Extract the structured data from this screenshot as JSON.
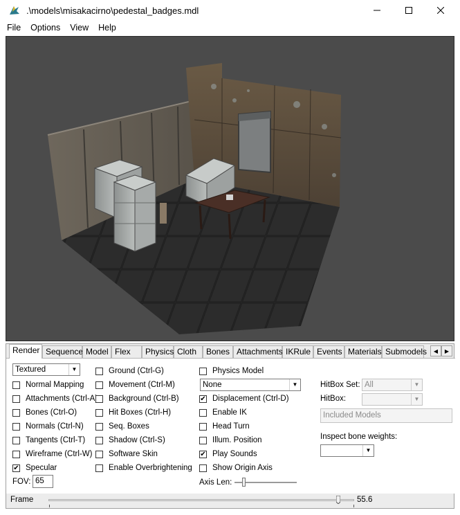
{
  "window": {
    "title": ".\\models\\misakacirno\\pedestal_badges.mdl",
    "icon": "hlmv-app-icon"
  },
  "menu": [
    "File",
    "Options",
    "View",
    "Help"
  ],
  "tabs": [
    "Render",
    "Sequence",
    "Model",
    "Flex",
    "Physics",
    "Cloth",
    "Bones",
    "Attachments",
    "IKRule",
    "Events",
    "Materials",
    "Submodels"
  ],
  "active_tab": "Render",
  "render": {
    "render_mode": "Textured",
    "col1": [
      {
        "label": "Normal Mapping",
        "checked": false
      },
      {
        "label": "Attachments (Ctrl-A)",
        "checked": false
      },
      {
        "label": "Bones (Ctrl-O)",
        "checked": false
      },
      {
        "label": "Normals (Ctrl-N)",
        "checked": false
      },
      {
        "label": "Tangents (Ctrl-T)",
        "checked": false
      },
      {
        "label": "Wireframe (Ctrl-W)",
        "checked": false
      },
      {
        "label": "Specular",
        "checked": true
      }
    ],
    "fov_label": "FOV:",
    "fov_value": "65",
    "col2": [
      {
        "label": "Ground (Ctrl-G)",
        "checked": false
      },
      {
        "label": "Movement (Ctrl-M)",
        "checked": false
      },
      {
        "label": "Background (Ctrl-B)",
        "checked": false
      },
      {
        "label": "Hit Boxes (Ctrl-H)",
        "checked": false
      },
      {
        "label": "Seq. Boxes",
        "checked": false
      },
      {
        "label": "Shadow (Ctrl-S)",
        "checked": false
      },
      {
        "label": "Software Skin",
        "checked": false
      },
      {
        "label": "Enable Overbrightening",
        "checked": false
      }
    ],
    "physics_model": {
      "label": "Physics Model",
      "checked": false
    },
    "physics_select": "None",
    "col3": [
      {
        "label": "Displacement (Ctrl-D)",
        "checked": true
      },
      {
        "label": "Enable IK",
        "checked": false
      },
      {
        "label": "Head Turn",
        "checked": false
      },
      {
        "label": "Illum. Position",
        "checked": false
      },
      {
        "label": "Play Sounds",
        "checked": true
      },
      {
        "label": "Show Origin Axis",
        "checked": false
      }
    ],
    "axis_len_label": "Axis Len:",
    "axis_len_value": 0.13,
    "hitbox_set_label": "HitBox Set:",
    "hitbox_set_value": "All",
    "hitbox_label": "HitBox:",
    "hitbox_value": "",
    "included_models": "Included Models",
    "inspect_label": "Inspect bone weights:",
    "inspect_value": ""
  },
  "status": {
    "frame_label": "Frame",
    "frame_value": "55.6",
    "frame_fraction": 0.95
  }
}
